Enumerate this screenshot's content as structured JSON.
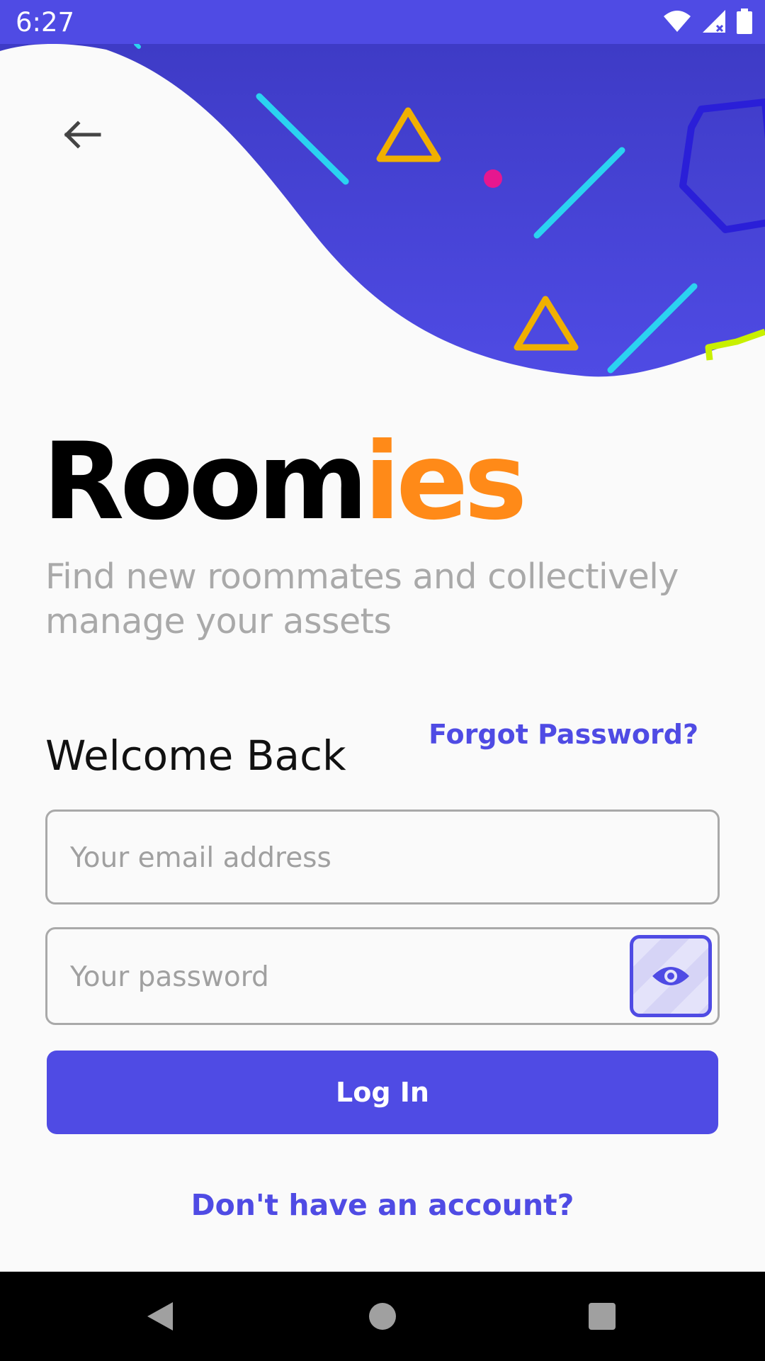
{
  "status_bar": {
    "time": "6:27",
    "icons": [
      "wifi-icon",
      "cellular-signal-icon",
      "battery-icon"
    ]
  },
  "header": {
    "back_icon": "arrow-left-icon",
    "decor_colors": [
      "#4F4BE4",
      "#3F3BC8",
      "#F0B000",
      "#2BD3F0",
      "#E6178F",
      "#2A1FD8",
      "#C8F000"
    ]
  },
  "brand": {
    "name_part1": "Room",
    "name_part2": "ies",
    "text_color": "#000000",
    "accent": "#FF8A18"
  },
  "tagline": "Find new roommates and collectively manage your assets",
  "form": {
    "title": "Welcome Back",
    "forgot_link": "Forgot Password?",
    "email_placeholder": "Your email address",
    "email_value": "",
    "password_placeholder": "Your password",
    "password_value": "",
    "visibility_icon": "eye-icon",
    "login_label": "Log In",
    "signup_link": "Don't have an account?"
  },
  "theme": {
    "primary": "#4F4BE4",
    "muted_text": "#A9A9A9",
    "background": "#FAFAFA"
  },
  "nav": {
    "items": [
      "back-triangle-icon",
      "home-circle-icon",
      "recents-square-icon"
    ]
  }
}
